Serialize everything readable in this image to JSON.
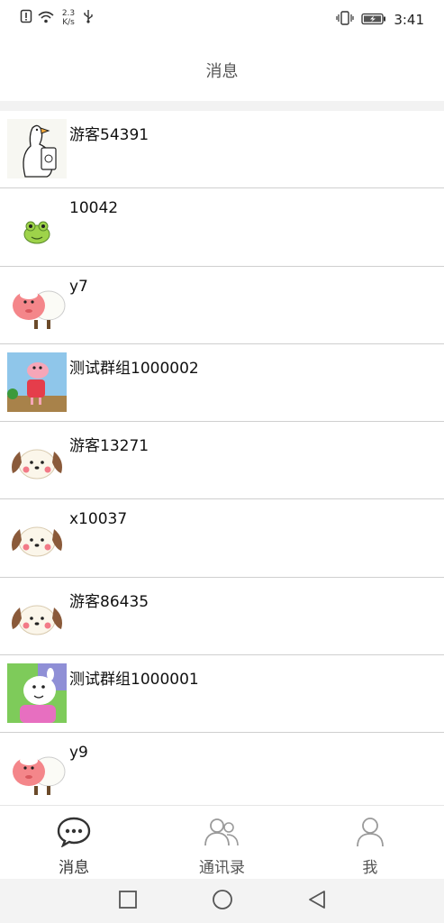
{
  "status_bar": {
    "speed_value": "2.3",
    "speed_unit": "K/s",
    "time": "3:41"
  },
  "header": {
    "title": "消息"
  },
  "conversations": [
    {
      "name": "游客54391",
      "avatar": "goose-avatar"
    },
    {
      "name": "10042",
      "avatar": "frog-avatar"
    },
    {
      "name": "y7",
      "avatar": "sheep-avatar"
    },
    {
      "name": "测试群组1000002",
      "avatar": "peppa-avatar"
    },
    {
      "name": "游客13271",
      "avatar": "puppy-avatar"
    },
    {
      "name": "x10037",
      "avatar": "puppy-avatar"
    },
    {
      "name": "游客86435",
      "avatar": "puppy-avatar"
    },
    {
      "name": "测试群组1000001",
      "avatar": "suzy-sheep-avatar"
    },
    {
      "name": "y9",
      "avatar": "sheep-avatar"
    }
  ],
  "tabs": [
    {
      "label": "消息",
      "icon": "chat-bubble-icon",
      "active": true
    },
    {
      "label": "通讯录",
      "icon": "contacts-icon",
      "active": false
    },
    {
      "label": "我",
      "icon": "profile-icon",
      "active": false
    }
  ],
  "colors": {
    "separator": "#cfcfcf",
    "section_gap": "#f2f2f2",
    "tab_icon": "#333333",
    "tab_icon_inactive": "#9a9a9a"
  }
}
